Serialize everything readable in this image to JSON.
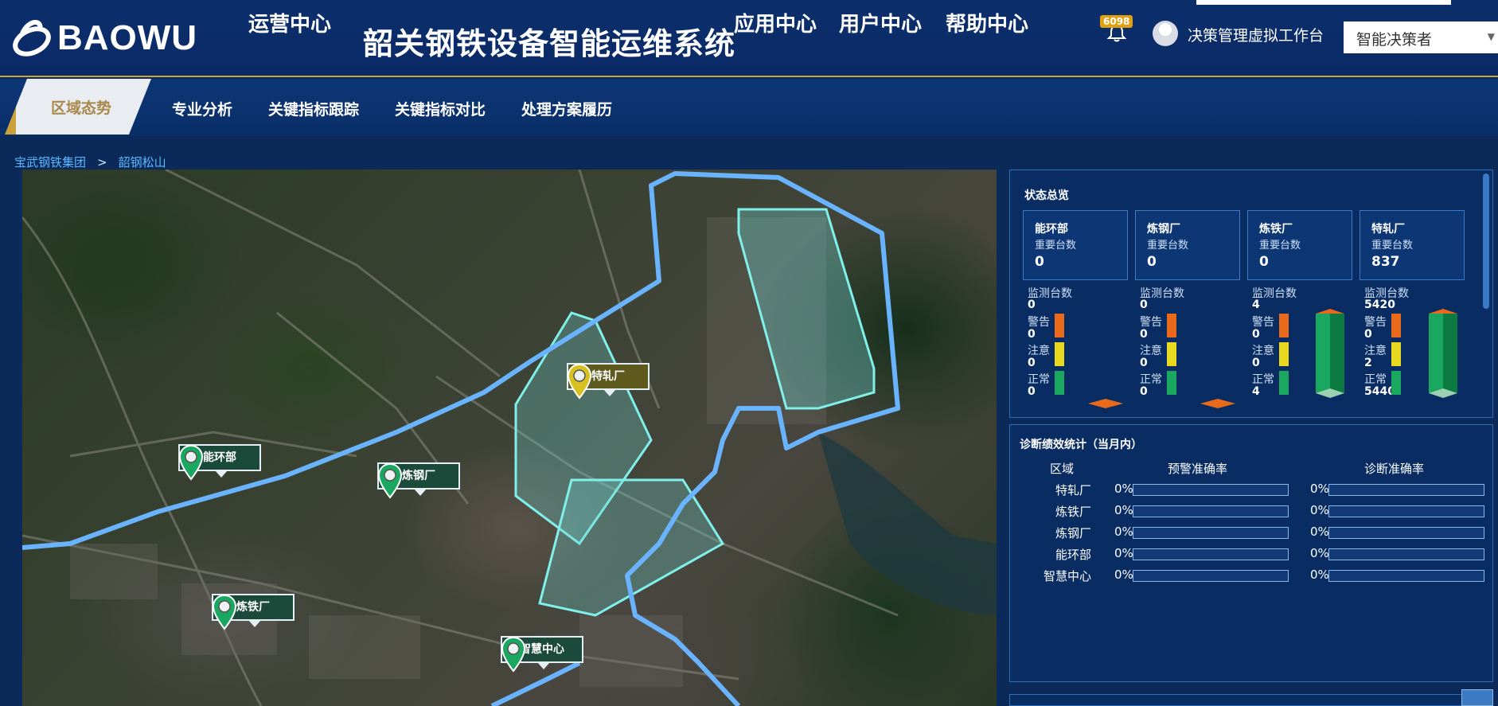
{
  "header": {
    "logo_text": "BAOWU",
    "nav_left": "运营中心",
    "system_title": "韶关钢铁设备智能运维系统",
    "nav_right": [
      "应用中心",
      "用户中心",
      "帮助中心"
    ],
    "notification_count": "6098",
    "user_label": "决策管理虚拟工作台",
    "role_value": "智能决策者"
  },
  "subnav": {
    "active": "区域态势",
    "items": [
      "专业分析",
      "关键指标跟踪",
      "关键指标对比",
      "处理方案履历"
    ]
  },
  "breadcrumb": [
    "宝武钢铁集团",
    ">",
    "韶钢松山"
  ],
  "map": {
    "markers": [
      {
        "label": "特轧厂",
        "style": "gold"
      },
      {
        "label": "能环部",
        "style": "green"
      },
      {
        "label": "炼钢厂",
        "style": "green"
      },
      {
        "label": "炼铁厂",
        "style": "green"
      },
      {
        "label": "智慧中心",
        "style": "green"
      }
    ]
  },
  "status_panel": {
    "title": "状态总览",
    "cards": [
      {
        "name": "能环部",
        "sub": "重要台数",
        "value": "0"
      },
      {
        "name": "炼钢厂",
        "sub": "重要台数",
        "value": "0"
      },
      {
        "name": "炼铁厂",
        "sub": "重要台数",
        "value": "0"
      },
      {
        "name": "特轧厂",
        "sub": "重要台数",
        "value": "837"
      }
    ],
    "stat_labels": {
      "monitor": "监测台数",
      "warn": "警告",
      "caution": "注意",
      "normal": "正常"
    },
    "stats": [
      {
        "monitor": "0",
        "warn": "0",
        "caution": "0",
        "normal": "0"
      },
      {
        "monitor": "0",
        "warn": "0",
        "caution": "0",
        "normal": "0"
      },
      {
        "monitor": "4",
        "warn": "0",
        "caution": "0",
        "normal": "4"
      },
      {
        "monitor": "5420",
        "warn": "0",
        "caution": "2",
        "normal": "5440"
      }
    ],
    "colors": {
      "warn": "#e86a1a",
      "caution": "#e8d820",
      "normal": "#1aa860"
    }
  },
  "perf_panel": {
    "title": "诊断绩效统计（当月内）",
    "headers": [
      "区域",
      "预警准确率",
      "诊断准确率"
    ],
    "rows": [
      {
        "area": "特轧厂",
        "warn_rate": "0%",
        "diag_rate": "0%"
      },
      {
        "area": "炼铁厂",
        "warn_rate": "0%",
        "diag_rate": "0%"
      },
      {
        "area": "炼钢厂",
        "warn_rate": "0%",
        "diag_rate": "0%"
      },
      {
        "area": "能环部",
        "warn_rate": "0%",
        "diag_rate": "0%"
      },
      {
        "area": "智慧中心",
        "warn_rate": "0%",
        "diag_rate": "0%"
      }
    ]
  }
}
